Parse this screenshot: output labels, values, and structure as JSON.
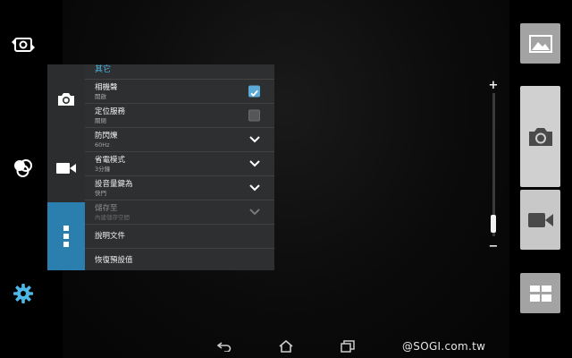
{
  "settings": {
    "section_title": "其它",
    "rows": [
      {
        "title": "相機聲",
        "subtitle": "開啟",
        "control": "checkbox",
        "checked": true,
        "enabled": true
      },
      {
        "title": "定位服務",
        "subtitle": "關閉",
        "control": "checkbox",
        "checked": false,
        "enabled": true
      },
      {
        "title": "防閃爍",
        "subtitle": "60Hz",
        "control": "dropdown",
        "enabled": true
      },
      {
        "title": "省電模式",
        "subtitle": "3分鐘",
        "control": "dropdown",
        "enabled": true
      },
      {
        "title": "設音量鍵為",
        "subtitle": "快門",
        "control": "dropdown",
        "enabled": true
      },
      {
        "title": "儲存至",
        "subtitle": "內建儲存空間",
        "control": "dropdown",
        "enabled": false
      },
      {
        "title": "說明文件",
        "subtitle": "",
        "control": "none",
        "enabled": true
      },
      {
        "title": "恢復預設值",
        "subtitle": "",
        "control": "none",
        "enabled": true
      }
    ],
    "tabs": [
      "camera-icon",
      "video-icon",
      "more-icon"
    ],
    "active_tab": "more-icon"
  },
  "left_rail": {
    "icons": [
      "switch-camera-icon",
      "effects-icon",
      "settings-gear-icon"
    ]
  },
  "zoom": {
    "plus_label": "+",
    "minus_label": "−",
    "level": 0.0
  },
  "right_rail": {
    "icons": [
      "gallery-icon",
      "shutter-camera-icon",
      "record-video-icon",
      "mode-grid-icon"
    ]
  },
  "navbar": {
    "icons": [
      "back-icon",
      "home-icon",
      "recent-apps-icon"
    ]
  },
  "watermark": "@SOGI.com.tw",
  "colors": {
    "accent": "#2a7fae",
    "section_title": "#4fb7e8",
    "gear": "#4fb7e8",
    "checkbox_on": "#5aa9d6"
  }
}
